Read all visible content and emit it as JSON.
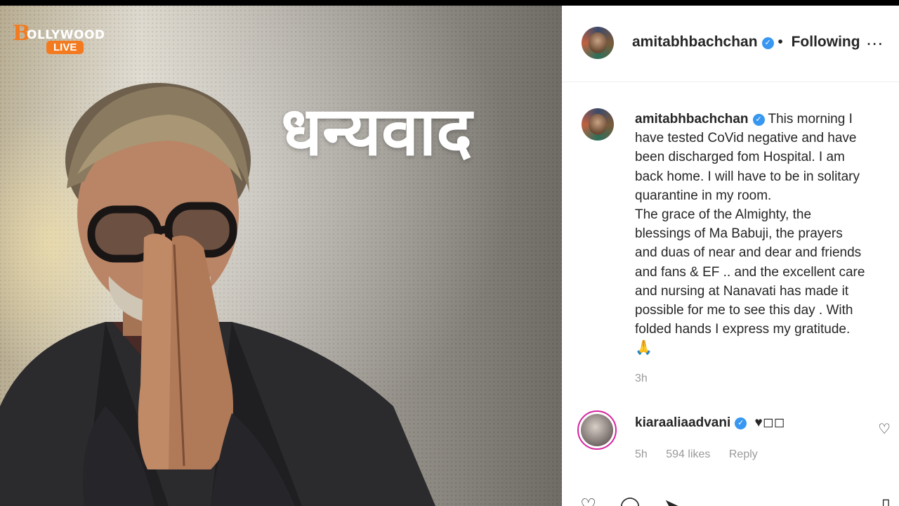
{
  "image": {
    "logo_initial": "B",
    "logo_text": "OLLYWOOD",
    "logo_badge": "LIVE",
    "overlay_text": "धन्यवाद",
    "accent_color": "#f37a1f"
  },
  "post": {
    "header": {
      "username": "amitabhbachchan",
      "verified_icon": "verified-badge-icon",
      "separator": "•",
      "follow_status": "Following",
      "more_label": "..."
    },
    "caption": {
      "username": "amitabhbachchan",
      "lines": [
        "This morning I",
        "have tested CoVid negative and have",
        "been discharged fom Hospital. I am",
        "back home. I will have to be in solitary",
        "quarantine in my room.",
        "The grace of the Almighty, the",
        "blessings of Ma Babuji, the prayers",
        "and duas of near and dear and friends",
        "and fans & EF .. and the excellent care",
        "and nursing at Nanavati has made it",
        "possible for me to see this day . With",
        "folded hands I express my gratitude."
      ],
      "emoji": "🙏",
      "time": "3h"
    },
    "comment": {
      "username": "kiaraaliaadvani",
      "text": "♥◻◻",
      "time": "5h",
      "likes": "594 likes",
      "reply": "Reply"
    },
    "icons": {
      "like": "heart-icon",
      "comment": "comment-icon",
      "share": "share-icon",
      "save": "bookmark-icon"
    },
    "brand_color": "#3897f0"
  }
}
